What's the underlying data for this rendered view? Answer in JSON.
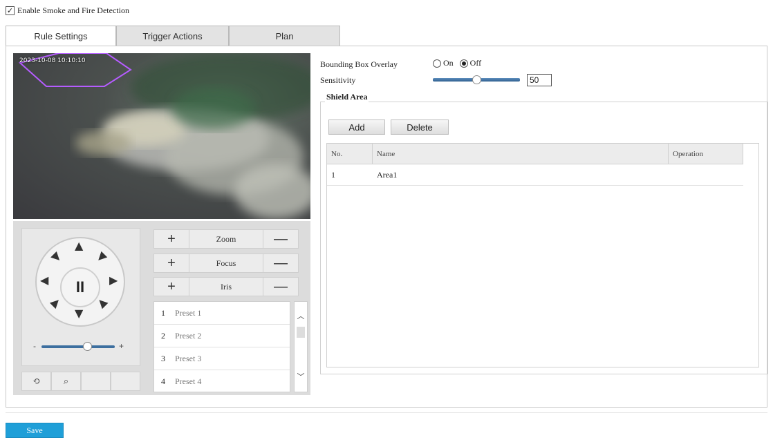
{
  "header": {
    "enable_label": "Enable Smoke and Fire Detection",
    "enable_checked": true
  },
  "tabs": [
    {
      "label": "Rule Settings",
      "active": true
    },
    {
      "label": "Trigger Actions",
      "active": false
    },
    {
      "label": "Plan",
      "active": false
    }
  ],
  "video": {
    "osd_text": "2023-10-08 10:10:10"
  },
  "ptz": {
    "zoom_label": "Zoom",
    "focus_label": "Focus",
    "iris_label": "Iris",
    "plus": "+",
    "minus": "—",
    "pause": "II",
    "speed_min": "-",
    "speed_max": "+",
    "speed_level": 0.62,
    "bottom_icons": [
      "camera-rotate-icon",
      "zoom-area-icon",
      "",
      ""
    ]
  },
  "presets": [
    {
      "num": "1",
      "name": "Preset 1"
    },
    {
      "num": "2",
      "name": "Preset 2"
    },
    {
      "num": "3",
      "name": "Preset 3"
    },
    {
      "num": "4",
      "name": "Preset 4"
    }
  ],
  "settings": {
    "bbox_label": "Bounding Box Overlay",
    "on_label": "On",
    "off_label": "Off",
    "bbox_value": "off",
    "sensitivity_label": "Sensitivity",
    "sensitivity_value": "50",
    "sensitivity_level": 0.5
  },
  "shield": {
    "title": "Shield Area",
    "add_label": "Add",
    "delete_label": "Delete",
    "columns": [
      "No.",
      "Name",
      "Operation"
    ],
    "rows": [
      {
        "no": "1",
        "name": "Area1",
        "operation": ""
      }
    ]
  },
  "footer": {
    "save_label": "Save"
  },
  "colors": {
    "save": "#1f9fd8",
    "slider": "#3d6f9f",
    "roi": "#b55cff"
  }
}
